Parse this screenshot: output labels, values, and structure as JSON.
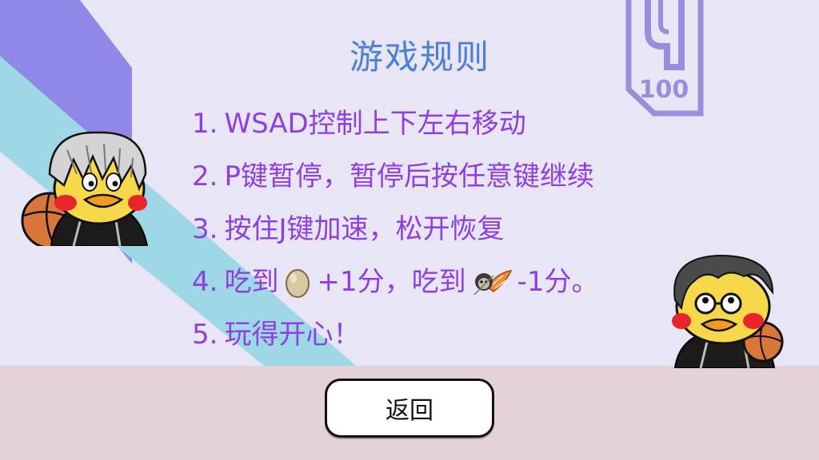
{
  "title": "游戏规则",
  "rules": [
    {
      "num": "1.",
      "text": "WSAD控制上下左右移动"
    },
    {
      "num": "2.",
      "text": "P键暂停，暂停后按任意键继续"
    },
    {
      "num": "3.",
      "text": "按住J键加速，松开恢复"
    },
    {
      "num": "4.",
      "before": "吃到",
      "plus": "+1分，吃到",
      "minus": "-1分。",
      "good_icon": "egg-icon",
      "bad_icon": "rat-icon"
    },
    {
      "num": "5.",
      "text": "玩得开心！"
    }
  ],
  "logo": {
    "number": "100"
  },
  "back_button": {
    "label": "返回"
  },
  "colors": {
    "background": "#e8e6f4",
    "title": "#4c7fd8",
    "rule_text": "#8f3fe0",
    "stripe_purple": "#9088e6",
    "stripe_cyan": "#9ed8e6",
    "floor": "#e3d2d8",
    "logo": "#9a8edc"
  }
}
